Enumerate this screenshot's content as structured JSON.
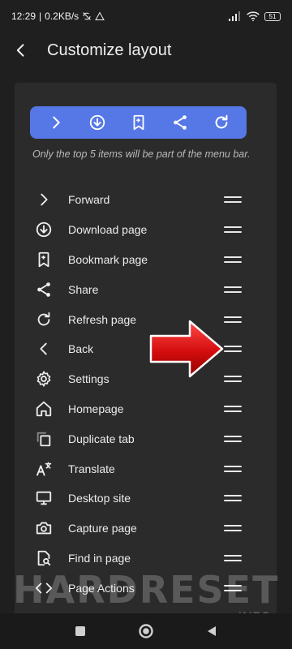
{
  "status_bar": {
    "time": "12:29",
    "speed": "0.2KB/s",
    "battery": "51"
  },
  "header": {
    "title": "Customize layout"
  },
  "menu_bar": {
    "icons": [
      "chevron-right-icon",
      "download-icon",
      "bookmark-icon",
      "share-icon",
      "refresh-icon"
    ],
    "background": "#5677e6"
  },
  "hint": "Only the top 5 items will be part of the menu bar.",
  "items": [
    {
      "label": "Forward",
      "icon": "chevron-right-icon"
    },
    {
      "label": "Download page",
      "icon": "download-icon"
    },
    {
      "label": "Bookmark page",
      "icon": "bookmark-icon"
    },
    {
      "label": "Share",
      "icon": "share-icon"
    },
    {
      "label": "Refresh page",
      "icon": "refresh-icon"
    },
    {
      "label": "Back",
      "icon": "chevron-left-icon"
    },
    {
      "label": "Settings",
      "icon": "gear-icon"
    },
    {
      "label": "Homepage",
      "icon": "home-icon"
    },
    {
      "label": "Duplicate tab",
      "icon": "duplicate-icon"
    },
    {
      "label": "Translate",
      "icon": "translate-icon"
    },
    {
      "label": "Desktop site",
      "icon": "monitor-icon"
    },
    {
      "label": "Capture page",
      "icon": "camera-icon"
    },
    {
      "label": "Find in page",
      "icon": "find-in-page-icon"
    },
    {
      "label": "Page Actions",
      "icon": "code-icon"
    }
  ],
  "watermark": {
    "main": "HARDRESET",
    "sub": ".INFO"
  }
}
